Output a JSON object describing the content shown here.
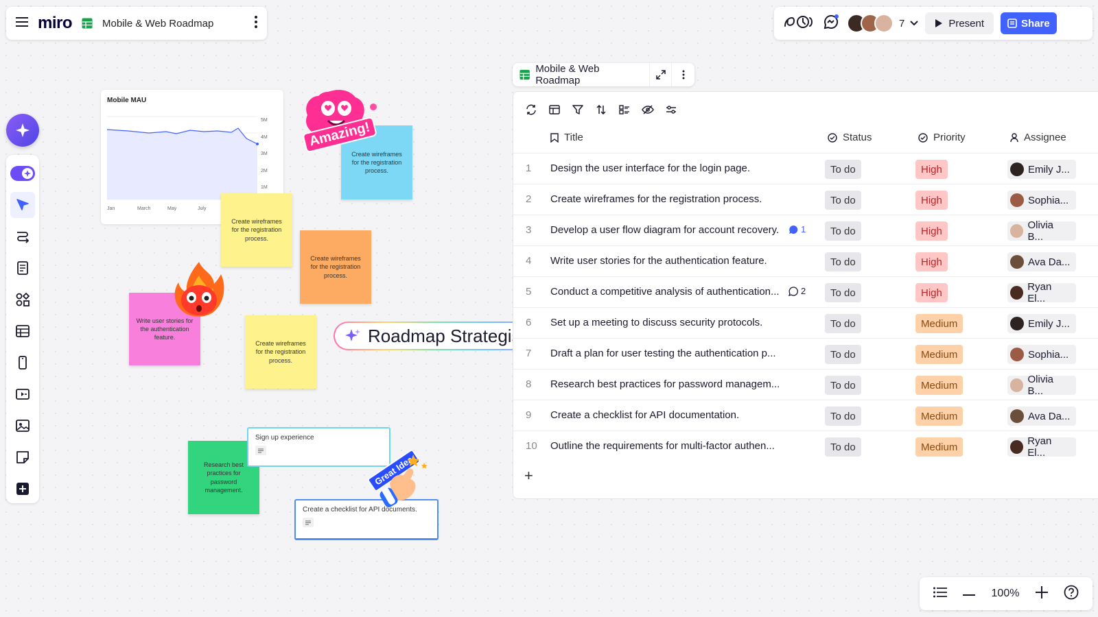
{
  "app": {
    "logo": "miro",
    "board_name": "Mobile & Web Roadmap",
    "collaborator_count": "7",
    "present_label": "Present",
    "share_label": "Share",
    "accent": "#4262ff"
  },
  "canvas": {
    "chart_title": "Mobile MAU",
    "chart_y_ticks": [
      "5M",
      "4M",
      "3M",
      "2M",
      "1M"
    ],
    "chart_x_ticks": [
      "Jan",
      "March",
      "May",
      "July"
    ],
    "stickies": [
      {
        "text": "Create wireframes for the registration process.",
        "color": "#7dd8f5"
      },
      {
        "text": "Create wireframes for the registration process.",
        "color": "#fdf28c"
      },
      {
        "text": "Create wireframes for the registration process.",
        "color": "#fdab63"
      },
      {
        "text": "Write user stories for the authentication feature.",
        "color": "#f97fdc"
      },
      {
        "text": "Create wireframes for the registration process.",
        "color": "#fdf28c"
      },
      {
        "text": "Research best practices for password management.",
        "color": "#32d57e"
      }
    ],
    "cards": [
      {
        "text": "Sign up experience"
      },
      {
        "text": "Create a checklist for API documents."
      }
    ],
    "stickers": {
      "amazing": "Amazing!",
      "great_idea": "Great Idea"
    },
    "strategist_label": "Roadmap Strategist"
  },
  "table": {
    "name": "Mobile & Web Roadmap",
    "columns": {
      "title": "Title",
      "status": "Status",
      "priority": "Priority",
      "assignee": "Assignee"
    },
    "rows": [
      {
        "num": "1",
        "title": "Design the user interface for the login page.",
        "status": "To do",
        "priority": "High",
        "assignee": "Emily J...",
        "comments": ""
      },
      {
        "num": "2",
        "title": "Create wireframes for the registration process.",
        "status": "To do",
        "priority": "High",
        "assignee": "Sophia...",
        "comments": ""
      },
      {
        "num": "3",
        "title": "Develop a user flow diagram for account recovery.",
        "status": "To do",
        "priority": "High",
        "assignee": "Olivia B...",
        "comments": "1"
      },
      {
        "num": "4",
        "title": "Write user stories for the authentication feature.",
        "status": "To do",
        "priority": "High",
        "assignee": "Ava Da...",
        "comments": ""
      },
      {
        "num": "5",
        "title": "Conduct a competitive analysis of authentication...",
        "status": "To do",
        "priority": "High",
        "assignee": "Ryan El...",
        "comments": "2"
      },
      {
        "num": "6",
        "title": "Set up a meeting to discuss security protocols.",
        "status": "To do",
        "priority": "Medium",
        "assignee": "Emily J...",
        "comments": ""
      },
      {
        "num": "7",
        "title": "Draft a plan for user testing the authentication p...",
        "status": "To do",
        "priority": "Medium",
        "assignee": "Sophia...",
        "comments": ""
      },
      {
        "num": "8",
        "title": "Research best practices for password managem...",
        "status": "To do",
        "priority": "Medium",
        "assignee": "Olivia B...",
        "comments": ""
      },
      {
        "num": "9",
        "title": "Create a checklist for API documentation.",
        "status": "To do",
        "priority": "Medium",
        "assignee": "Ava Da...",
        "comments": ""
      },
      {
        "num": "10",
        "title": "Outline the requirements for multi-factor authen...",
        "status": "To do",
        "priority": "Medium",
        "assignee": "Ryan El...",
        "comments": ""
      }
    ],
    "priority_colors": {
      "High": "#ffc6c6",
      "Medium": "#ffd1a8"
    },
    "add_label": "+"
  },
  "zoom": {
    "level": "100%"
  }
}
